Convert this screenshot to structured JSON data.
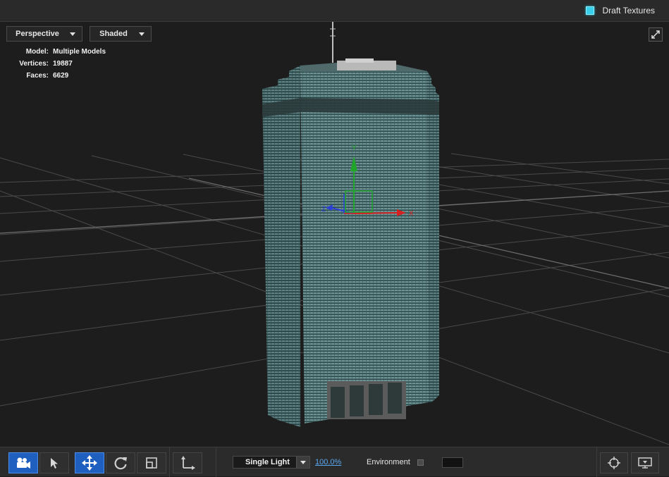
{
  "topbar": {
    "draft_textures_label": "Draft Textures",
    "draft_textures_checked": true,
    "accent_color": "#38d0ea"
  },
  "viewport": {
    "view_mode": "Perspective",
    "shading_mode": "Shaded",
    "stats": {
      "model_label": "Model:",
      "model_value": "Multiple Models",
      "vertices_label": "Vertices:",
      "vertices_value": "19887",
      "faces_label": "Faces:",
      "faces_value": "6629"
    },
    "gizmo": {
      "x_label": "X",
      "y_label": "Y",
      "z_label": "Z",
      "x_color": "#d42020",
      "y_color": "#1fa52a",
      "z_color": "#2a3fd8"
    },
    "icons": [
      "expand-icon"
    ]
  },
  "toolbar": {
    "tools": [
      {
        "name": "camera-tool",
        "icon": "camera-icon",
        "active": true
      },
      {
        "name": "select-tool",
        "icon": "pointer-icon",
        "active": false
      },
      {
        "name": "move-tool",
        "icon": "move-icon",
        "active": true
      },
      {
        "name": "rotate-tool",
        "icon": "rotate-icon",
        "active": false
      },
      {
        "name": "scale-tool",
        "icon": "scale-icon",
        "active": false
      },
      {
        "name": "axis-tool",
        "icon": "axis-icon",
        "active": false
      }
    ],
    "light_mode": "Single Light",
    "light_intensity": "100.0%",
    "environment_label": "Environment",
    "environment_checked": false,
    "right_icons": [
      "target-icon",
      "monitor-icon"
    ],
    "active_color": "#1f5fbf"
  }
}
